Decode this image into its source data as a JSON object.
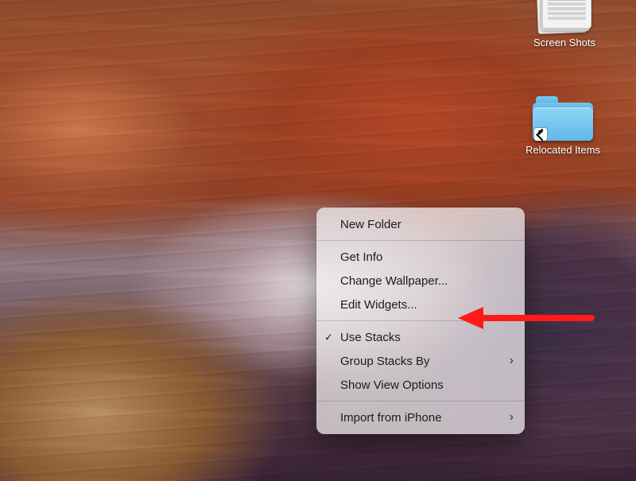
{
  "desktop_icons": {
    "screenshots": {
      "label": "Screen Shots"
    },
    "relocated": {
      "label": "Relocated Items"
    }
  },
  "context_menu": {
    "new_folder": "New Folder",
    "get_info": "Get Info",
    "change_wallpaper": "Change Wallpaper...",
    "edit_widgets": "Edit Widgets...",
    "use_stacks": "Use Stacks",
    "group_stacks_by": "Group Stacks By",
    "show_view_options": "Show View Options",
    "import_from_iphone": "Import from iPhone"
  },
  "annotation": {
    "color": "#ff1a1a",
    "points_to": "edit_widgets"
  }
}
